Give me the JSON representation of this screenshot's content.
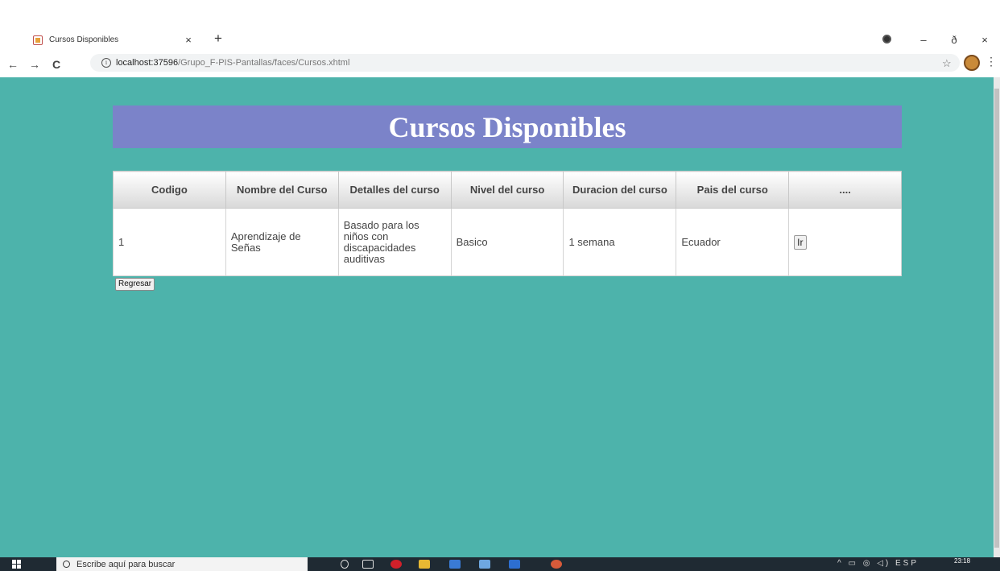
{
  "browser": {
    "tab_title": "Cursos Disponibles",
    "tab_close": "×",
    "new_tab": "+",
    "url_host": "localhost:37596",
    "url_path": "/Grupo_F-PIS-Pantallas/faces/Cursos.xhtml",
    "nav": {
      "back": "←",
      "forward": "→",
      "reload": "C"
    },
    "window": {
      "minimize": "–",
      "maximize": "ð",
      "close": "×"
    },
    "star": "☆",
    "menu": "⋮"
  },
  "page": {
    "title": "Cursos Disponibles",
    "table": {
      "headers": [
        "Codigo",
        "Nombre del Curso",
        "Detalles del curso",
        "Nivel del curso",
        "Duracion del curso",
        "Pais del curso",
        "...."
      ],
      "rows": [
        {
          "codigo": "1",
          "nombre": "Aprendizaje de Señas",
          "detalles": "Basado para los niños con discapacidades auditivas",
          "nivel": "Basico",
          "duracion": "1 semana",
          "pais": "Ecuador",
          "action_label": "Ir"
        }
      ]
    },
    "back_button": "Regresar"
  },
  "taskbar": {
    "search_placeholder": "Escribe aquí para buscar",
    "clock": "23:18",
    "lang": "ESP"
  },
  "colors": {
    "page_bg": "#4db3ab",
    "banner_bg": "#7b83c9",
    "taskbar_bg": "#1f2a33"
  }
}
